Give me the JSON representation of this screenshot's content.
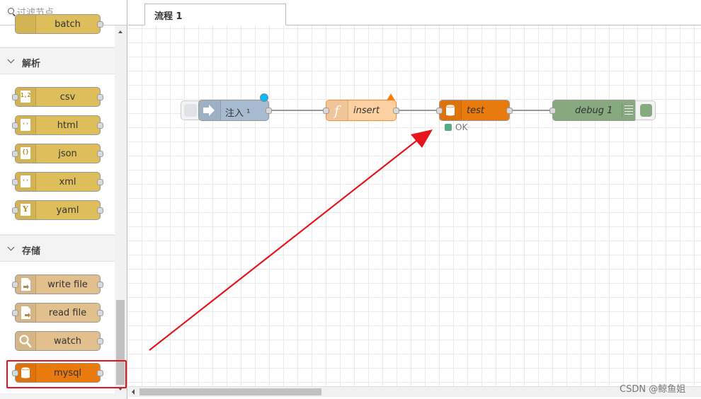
{
  "palette": {
    "search_placeholder": "过滤节点",
    "top_partial_node_label": "batch",
    "categories": [
      {
        "title": "解析",
        "nodes": [
          {
            "label": "csv",
            "icon": "csv-icon",
            "icon_text": "1,2"
          },
          {
            "label": "html",
            "icon": "html-icon",
            "icon_text": "‹›"
          },
          {
            "label": "json",
            "icon": "json-icon",
            "icon_text": "{}"
          },
          {
            "label": "xml",
            "icon": "xml-icon",
            "icon_text": "‹›"
          },
          {
            "label": "yaml",
            "icon": "yaml-icon",
            "icon_text": "Y"
          }
        ]
      },
      {
        "title": "存储",
        "nodes": [
          {
            "label": "write file",
            "icon": "write-file-icon"
          },
          {
            "label": "read file",
            "icon": "read-file-icon"
          },
          {
            "label": "watch",
            "icon": "magnifier-icon"
          },
          {
            "label": "mysql",
            "icon": "database-icon"
          }
        ]
      }
    ]
  },
  "tabs": [
    {
      "label": "流程 1",
      "active": true
    }
  ],
  "flow": {
    "nodes": [
      {
        "id": "inject",
        "label": "注入 ¹",
        "color": "#a6bbcf",
        "icon": "inject-arrow-icon"
      },
      {
        "id": "insert",
        "label": "insert",
        "color": "#fdd0a2",
        "icon": "function-icon"
      },
      {
        "id": "test",
        "label": "test",
        "color": "#e97a0d",
        "icon": "database-icon",
        "status": "OK"
      },
      {
        "id": "debug",
        "label": "debug 1",
        "color": "#87a980",
        "icon": "debug-list-icon"
      }
    ]
  },
  "watermark": "CSDN @鲸鱼姐",
  "colors": {
    "parser": "#debe5a",
    "storage": "#e2c08e",
    "mysql": "#e97a0d",
    "annotation_red": "#e8141b",
    "status_ok": "#55aa88"
  }
}
